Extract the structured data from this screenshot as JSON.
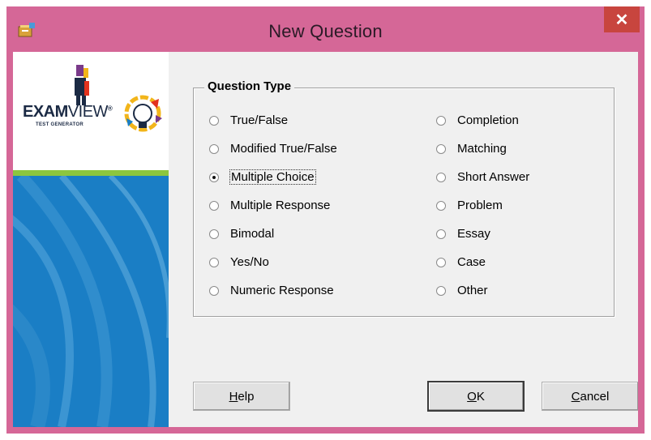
{
  "window": {
    "title": "New Question",
    "close_glyph": "✕"
  },
  "logo": {
    "brand_bold": "EXAM",
    "brand_light": "VIEW",
    "registered": "®",
    "subtitle": "TEST GENERATOR"
  },
  "question_type": {
    "legend": "Question Type",
    "left_options": [
      {
        "label": "True/False",
        "checked": false
      },
      {
        "label": "Modified True/False",
        "checked": false
      },
      {
        "label": "Multiple Choice",
        "checked": true
      },
      {
        "label": "Multiple Response",
        "checked": false
      },
      {
        "label": "Bimodal",
        "checked": false
      },
      {
        "label": "Yes/No",
        "checked": false
      },
      {
        "label": "Numeric Response",
        "checked": false
      }
    ],
    "right_options": [
      {
        "label": "Completion",
        "checked": false
      },
      {
        "label": "Matching",
        "checked": false
      },
      {
        "label": "Short Answer",
        "checked": false
      },
      {
        "label": "Problem",
        "checked": false
      },
      {
        "label": "Essay",
        "checked": false
      },
      {
        "label": "Case",
        "checked": false
      },
      {
        "label": "Other",
        "checked": false
      }
    ]
  },
  "buttons": {
    "help": {
      "mnemonic": "H",
      "rest": "elp"
    },
    "ok": {
      "mnemonic": "O",
      "rest": "K"
    },
    "cancel": {
      "mnemonic": "C",
      "rest": "ancel"
    }
  },
  "colors": {
    "titlebar": "#d56797",
    "close": "#c8453e",
    "sidebar_blue": "#1a7ec5",
    "sidebar_green": "#8cc63e"
  }
}
